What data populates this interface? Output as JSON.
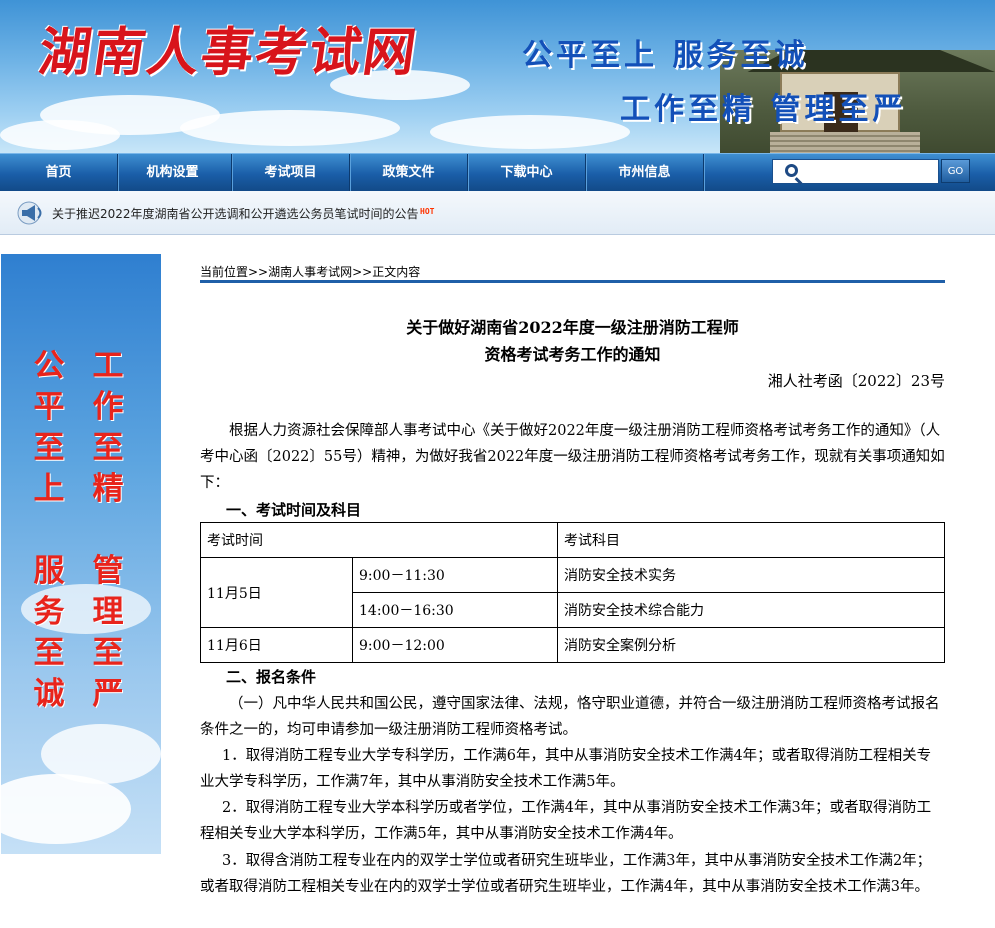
{
  "header": {
    "site_title": "湖南人事考试网",
    "slogan_line1": "公平至上 服务至诚",
    "slogan_line2": "工作至精 管理至严"
  },
  "nav": {
    "items": [
      {
        "label": "首页"
      },
      {
        "label": "机构设置"
      },
      {
        "label": "考试项目"
      },
      {
        "label": "政策文件"
      },
      {
        "label": "下载中心"
      },
      {
        "label": "市州信息"
      }
    ],
    "search_value": "",
    "go_label": "GO"
  },
  "notice": {
    "text": "关于推迟2022年度湖南省公开选调和公开遴选公务员笔试时间的公告",
    "badge": "HOT"
  },
  "sidebar": {
    "col1": [
      "公",
      "平",
      "至",
      "上",
      "",
      "服",
      "务",
      "至",
      "诚"
    ],
    "col2": [
      "工",
      "作",
      "至",
      "精",
      "",
      "管",
      "理",
      "至",
      "严"
    ]
  },
  "breadcrumb": "当前位置>>湖南人事考试网>>正文内容",
  "article": {
    "title_line1": "关于做好湖南省2022年度一级注册消防工程师",
    "title_line2": "资格考试考务工作的通知",
    "doc_number": "湘人社考函〔2022〕23号",
    "intro": "根据人力资源社会保障部人事考试中心《关于做好2022年度一级注册消防工程师资格考试考务工作的通知》（人考中心函〔2022〕55号）精神，为做好我省2022年度一级注册消防工程师资格考试考务工作，现就有关事项通知如下：",
    "section1": "一、考试时间及科目",
    "table": {
      "header_time": "考试时间",
      "header_subject": "考试科目",
      "rows": [
        {
          "date": "11月5日",
          "time": "9:00－11:30",
          "subject": "消防安全技术实务"
        },
        {
          "date": "",
          "time": "14:00－16:30",
          "subject": "消防安全技术综合能力"
        },
        {
          "date": "11月6日",
          "time": "9:00－12:00",
          "subject": "消防安全案例分析"
        }
      ]
    },
    "section2": "二、报名条件",
    "p1": "（一）凡中华人民共和国公民，遵守国家法律、法规，恪守职业道德，并符合一级注册消防工程师资格考试报名条件之一的，均可申请参加一级注册消防工程师资格考试。",
    "p2": "1．取得消防工程专业大学专科学历，工作满6年，其中从事消防安全技术工作满4年；或者取得消防工程相关专业大学专科学历，工作满7年，其中从事消防安全技术工作满5年。",
    "p3": "2．取得消防工程专业大学本科学历或者学位，工作满4年，其中从事消防安全技术工作满3年；或者取得消防工程相关专业大学本科学历，工作满5年，其中从事消防安全技术工作满4年。",
    "p4": "3．取得含消防工程专业在内的双学士学位或者研究生班毕业，工作满3年，其中从事消防安全技术工作满2年；或者取得消防工程相关专业在内的双学士学位或者研究生班毕业，工作满4年，其中从事消防安全技术工作满3年。"
  }
}
